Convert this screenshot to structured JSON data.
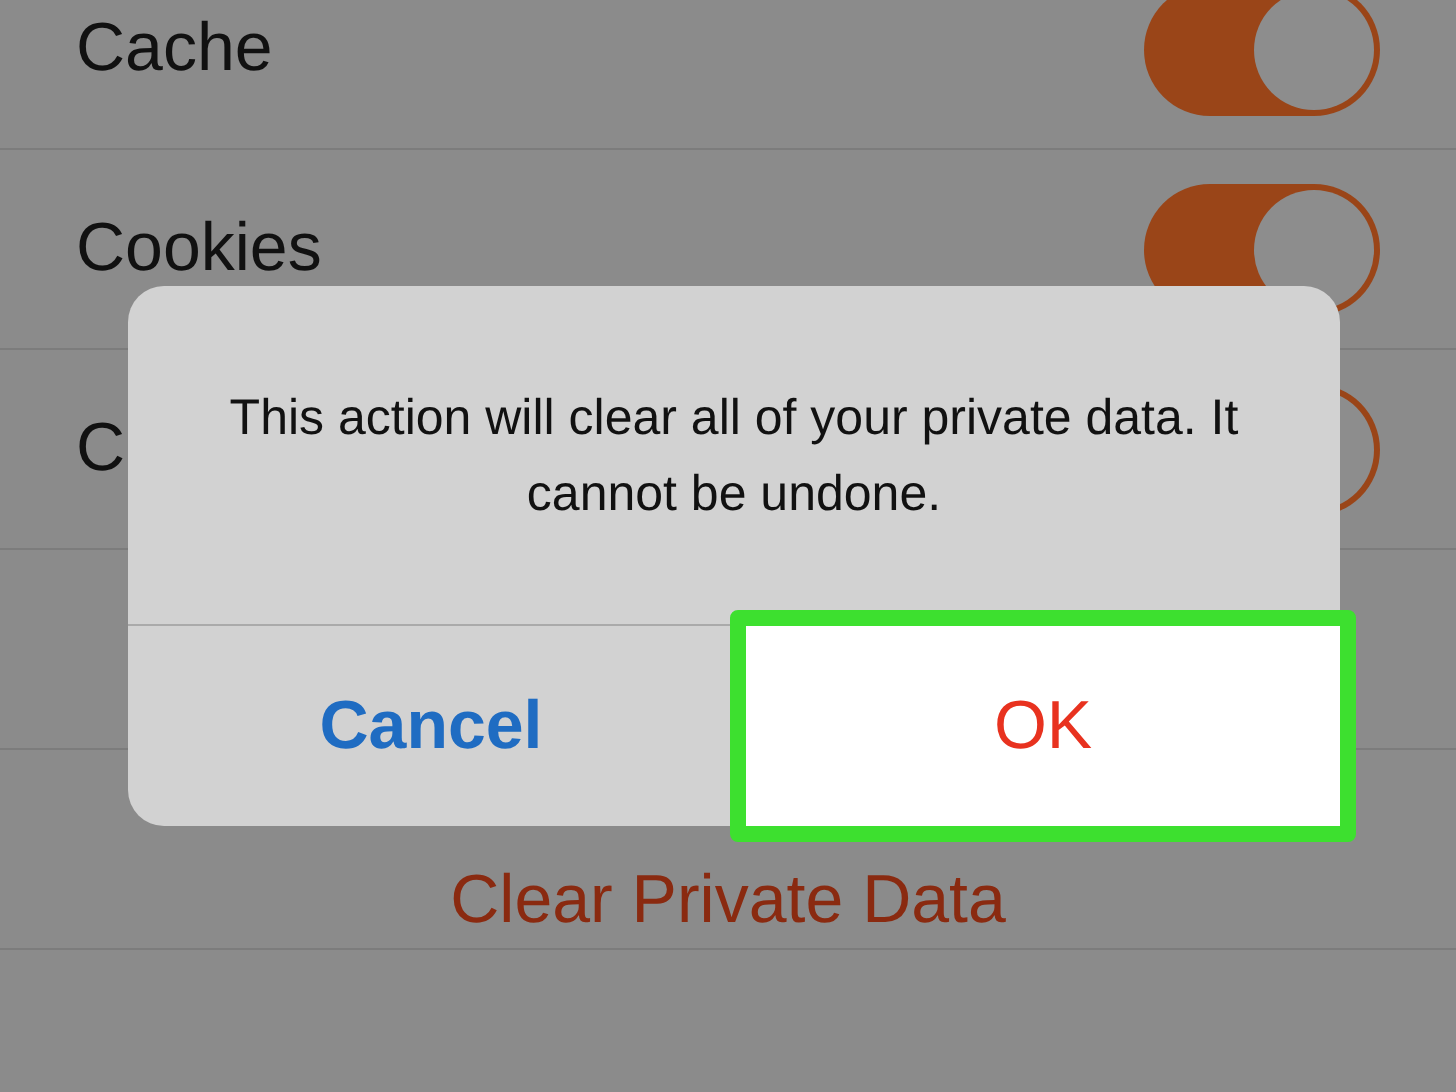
{
  "settings": [
    {
      "label": "Cache",
      "on": true
    },
    {
      "label": "Cookies",
      "on": true
    },
    {
      "label": "C",
      "on": true
    }
  ],
  "clear_button": "Clear Private Data",
  "dialog": {
    "message": "This action will clear all of your private data. It cannot be undone.",
    "buttons": [
      {
        "label": "Cancel",
        "kind": "cancel",
        "highlighted": false
      },
      {
        "label": "OK",
        "kind": "destructive",
        "highlighted": true
      }
    ]
  }
}
